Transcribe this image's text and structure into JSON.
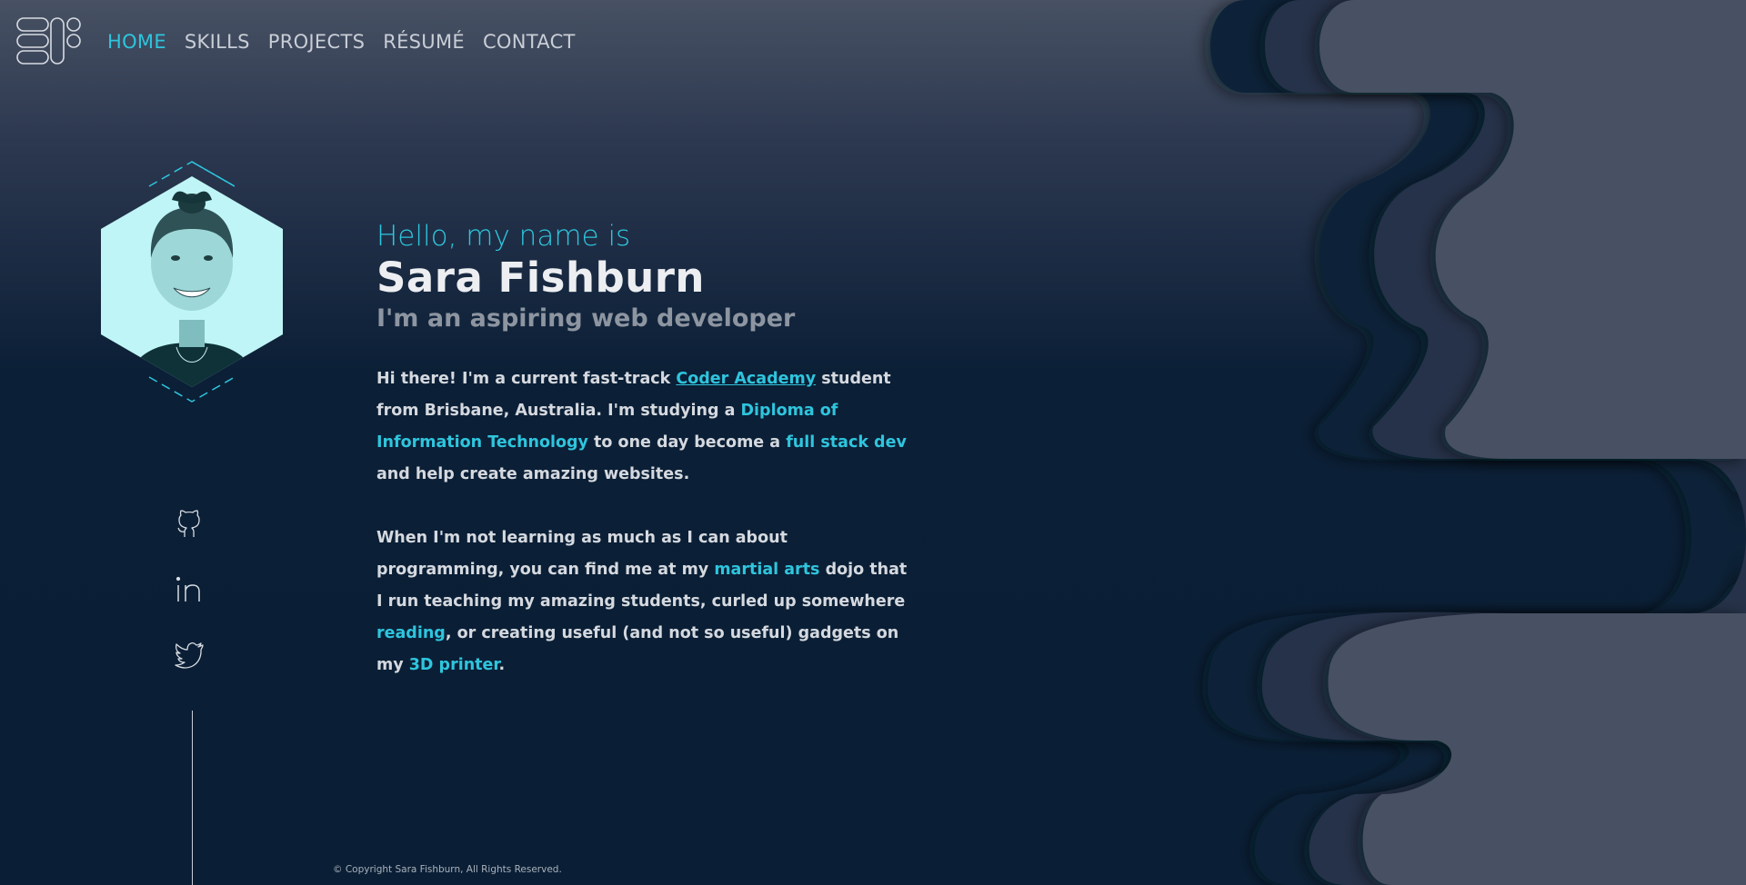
{
  "brand": {
    "logo_icon": "sf-monogram-logo-icon"
  },
  "nav": {
    "items": [
      {
        "label": "HOME",
        "active": true
      },
      {
        "label": "SKILLS",
        "active": false
      },
      {
        "label": "PROJECTS",
        "active": false
      },
      {
        "label": "RÉSUMÉ",
        "active": false
      },
      {
        "label": "CONTACT",
        "active": false
      }
    ]
  },
  "hero": {
    "greeting": "Hello, my name is",
    "name": "Sara Fishburn",
    "tagline": "I'm an aspiring web developer"
  },
  "bio": {
    "p1": {
      "t1": "Hi there! I'm a current fast-track ",
      "link1": "Coder Academy",
      "t2": " student from Brisbane, Australia. I'm studying a ",
      "hl1": "Diploma of Information Technology",
      "t3": " to one day become a ",
      "hl2": "full stack dev",
      "t4": " and help create amazing websites."
    },
    "p2": {
      "t1": "When I'm not learning as much as I can about programming, you can find me at my ",
      "hl1": "martial arts",
      "t2": " dojo that I run teaching my amazing students, curled up somewhere ",
      "hl2": "reading",
      "t3": ", or creating useful (and not so useful) gadgets on my ",
      "hl3": "3D printer",
      "t4": "."
    }
  },
  "social": {
    "icons": [
      "github-icon",
      "linkedin-icon",
      "twitter-icon"
    ]
  },
  "footer": {
    "copyright": "© Copyright Sara Fishburn, All Rights Reserved."
  },
  "colors": {
    "accent": "#2ec5dd",
    "background": "#0a1f36",
    "wave_light": "#475163",
    "wave_mid": "#27324a",
    "wave_dark": "#0d2239"
  }
}
